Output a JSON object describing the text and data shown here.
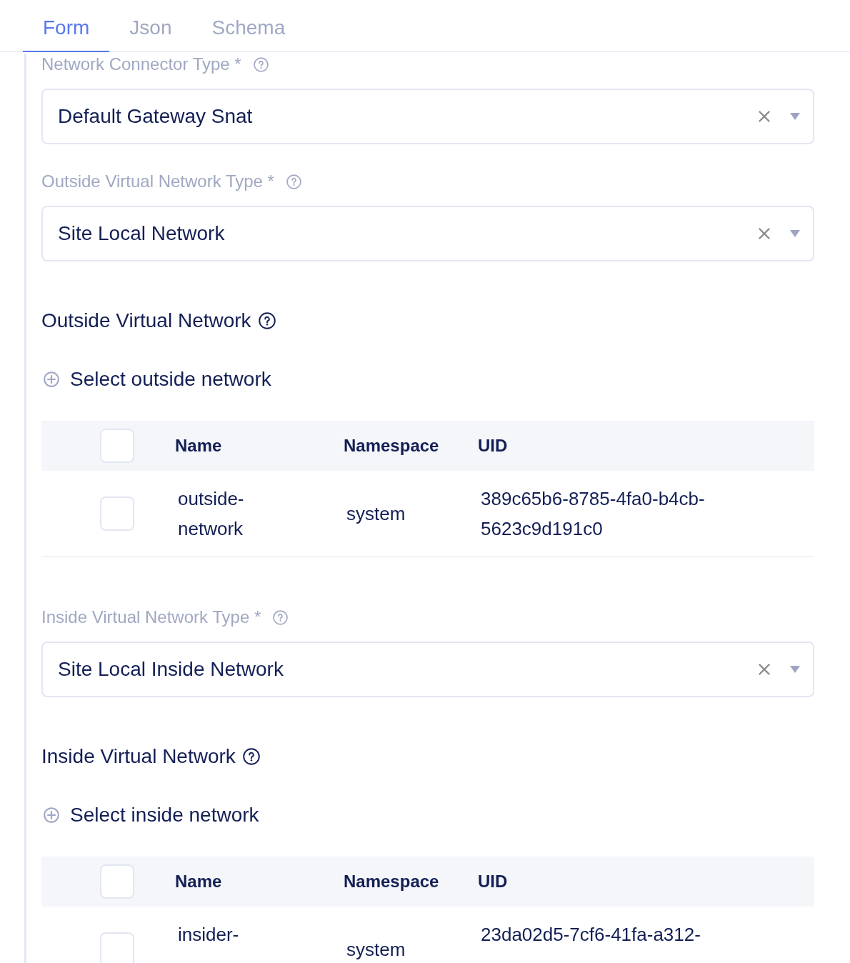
{
  "tabs": [
    {
      "label": "Form",
      "selected": true
    },
    {
      "label": "Json",
      "selected": false
    },
    {
      "label": "Schema",
      "selected": false
    }
  ],
  "form": [
    {
      "kind": "select",
      "label": "Network Connector Type *",
      "value": "Default Gateway Snat"
    },
    {
      "kind": "select",
      "label": "Outside Virtual Network Type *",
      "value": "Site Local Network"
    },
    {
      "kind": "picker",
      "title": "Outside Virtual Network",
      "action": "Select outside network",
      "table": {
        "all_checked": false,
        "columns": [
          "Name",
          "Namespace",
          "UID"
        ],
        "rows": [
          {
            "checked": false,
            "cells": [
              "outside-network",
              "system",
              "389c65b6-8785-4fa0-b4cb-5623c9d191c0"
            ]
          }
        ]
      }
    },
    {
      "kind": "select",
      "label": "Inside Virtual Network Type *",
      "value": "Site Local Inside Network"
    },
    {
      "kind": "picker",
      "title": "Inside Virtual Network",
      "action": "Select inside network",
      "table": {
        "all_checked": false,
        "columns": [
          "Name",
          "Namespace",
          "UID"
        ],
        "rows": [
          {
            "checked": false,
            "cells": [
              "insider-",
              "system",
              "23da02d5-7cf6-41fa-a312-"
            ]
          }
        ]
      }
    }
  ]
}
